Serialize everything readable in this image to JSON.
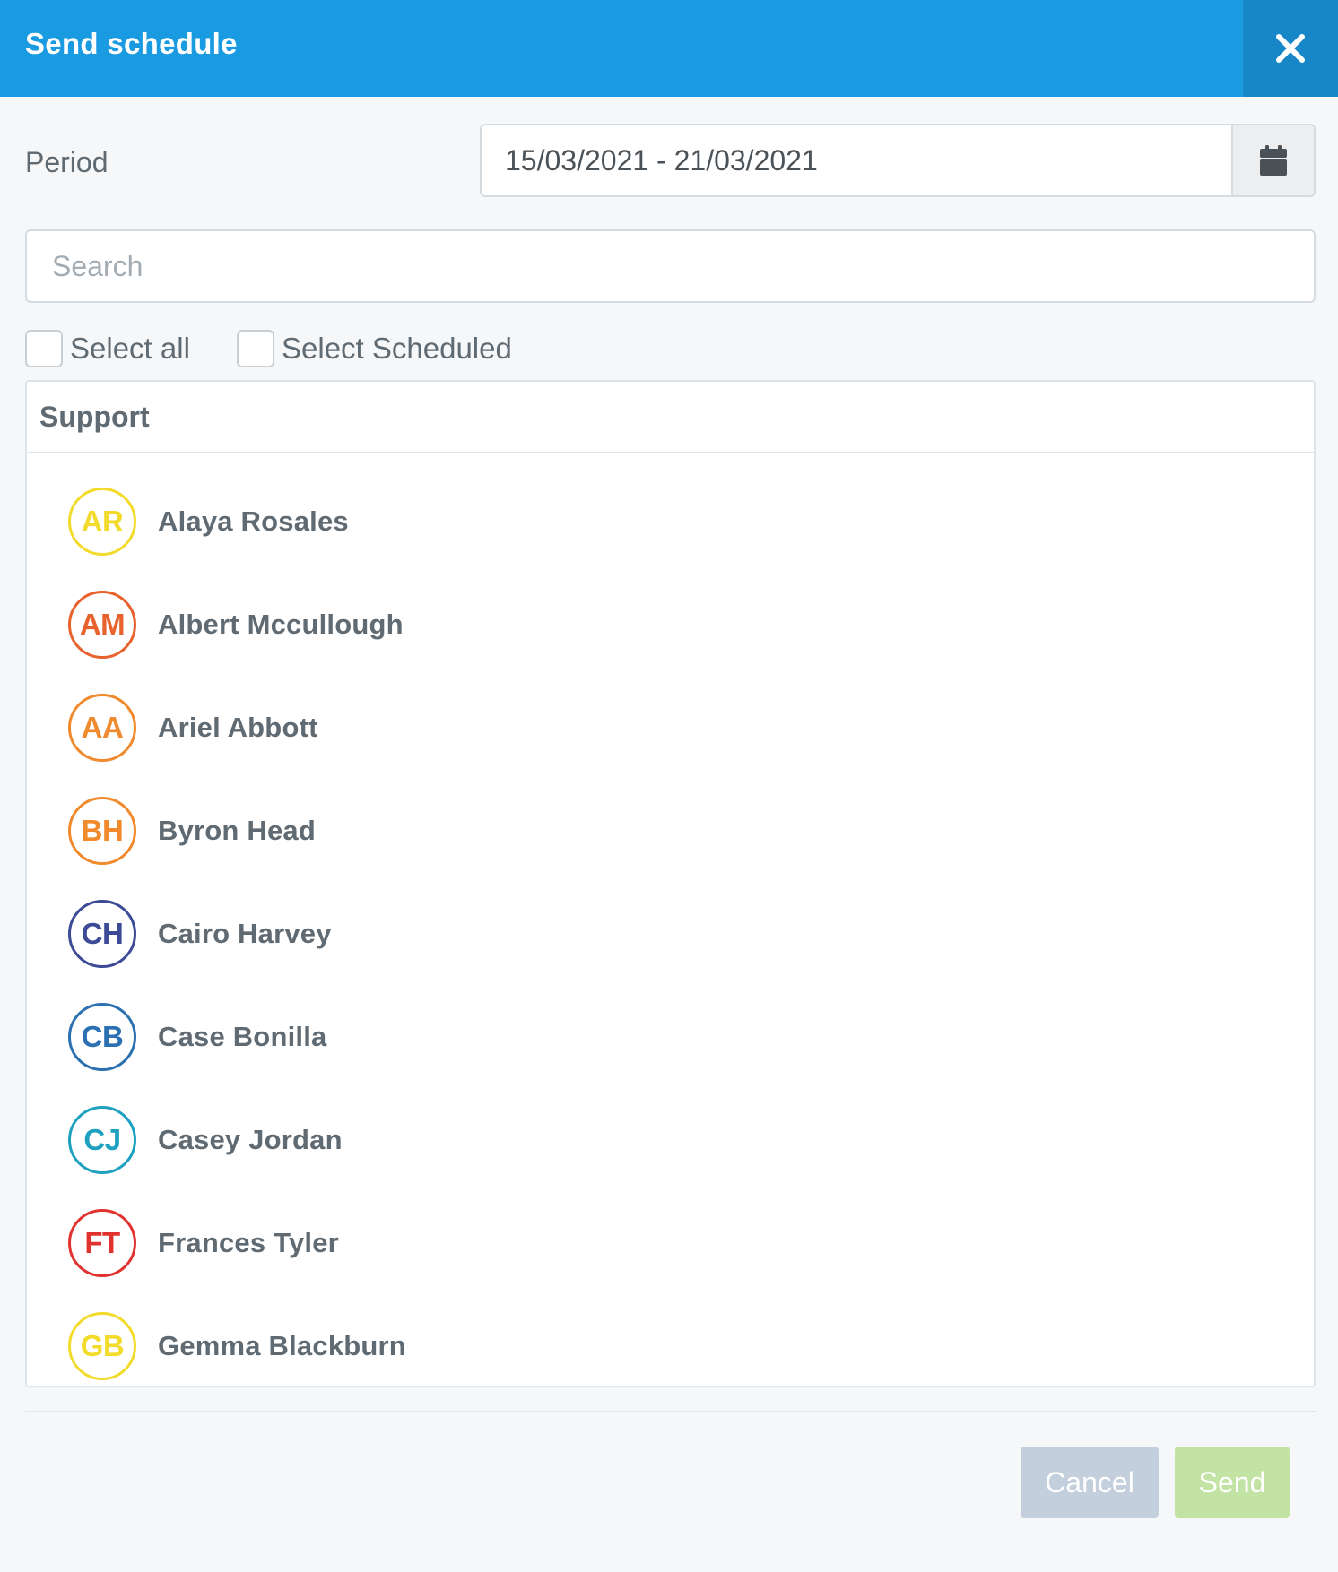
{
  "dialog": {
    "title": "Send schedule"
  },
  "period": {
    "label": "Period",
    "value": "15/03/2021 - 21/03/2021"
  },
  "search": {
    "placeholder": "Search",
    "value": ""
  },
  "filters": {
    "select_all_label": "Select all",
    "select_all_checked": false,
    "select_scheduled_label": "Select Scheduled",
    "select_scheduled_checked": false
  },
  "group": {
    "name": "Support",
    "members": [
      {
        "initials": "AR",
        "name": "Alaya Rosales",
        "color": "#f2db2b"
      },
      {
        "initials": "AM",
        "name": "Albert Mccullough",
        "color": "#e8622d"
      },
      {
        "initials": "AA",
        "name": "Ariel Abbott",
        "color": "#ef8a2e"
      },
      {
        "initials": "BH",
        "name": "Byron Head",
        "color": "#f08a2c"
      },
      {
        "initials": "CH",
        "name": "Cairo Harvey",
        "color": "#3d4a96"
      },
      {
        "initials": "CB",
        "name": "Case Bonilla",
        "color": "#2b70b0"
      },
      {
        "initials": "CJ",
        "name": "Casey Jordan",
        "color": "#1ea0c1"
      },
      {
        "initials": "FT",
        "name": "Frances Tyler",
        "color": "#e0322f"
      },
      {
        "initials": "GB",
        "name": "Gemma Blackburn",
        "color": "#f2db2b"
      }
    ]
  },
  "footer": {
    "cancel_label": "Cancel",
    "send_label": "Send"
  },
  "colors": {
    "header_bg": "#1a9ae1",
    "close_bg": "#1787c8",
    "cancel_bg": "#c3cfdc",
    "send_bg": "#c2e3a3"
  },
  "icons": {
    "close": "close-icon",
    "calendar": "calendar-icon"
  }
}
